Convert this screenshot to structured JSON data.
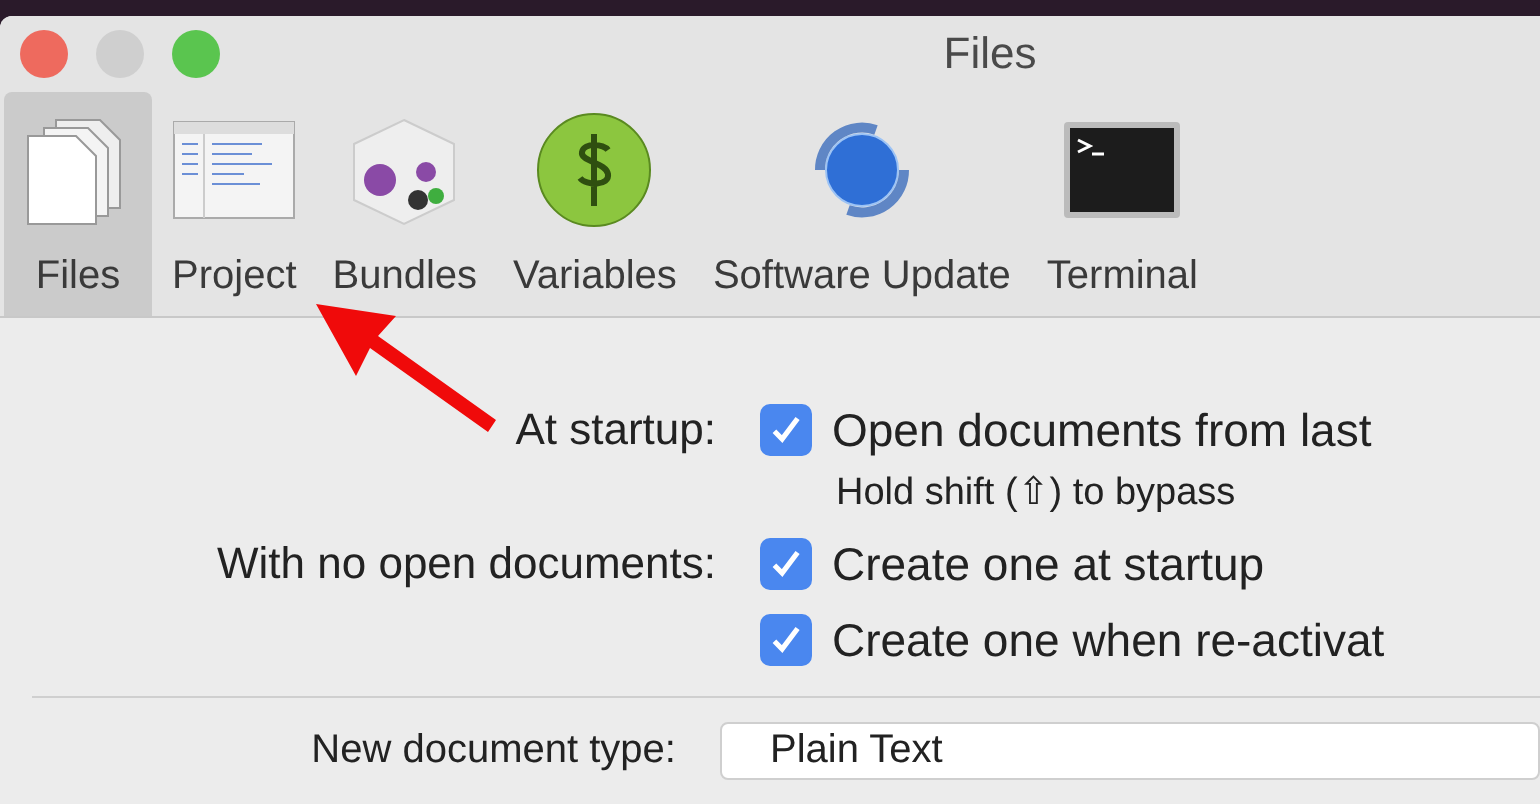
{
  "window": {
    "title": "Files"
  },
  "toolbar": [
    {
      "label": "Files",
      "selected": true
    },
    {
      "label": "Project",
      "selected": false
    },
    {
      "label": "Bundles",
      "selected": false
    },
    {
      "label": "Variables",
      "selected": false
    },
    {
      "label": "Software Update",
      "selected": false
    },
    {
      "label": "Terminal",
      "selected": false
    }
  ],
  "settings": [
    {
      "label": "At startup:",
      "option": "Open documents from last",
      "checked": true,
      "hint": "Hold shift (⇧) to bypass"
    },
    {
      "label": "With no open documents:",
      "option": "Create one at startup",
      "checked": true
    },
    {
      "option": "Create one when re-activat",
      "checked": true
    }
  ],
  "new_document_type": {
    "label": "New document type:",
    "value": "Plain Text"
  }
}
